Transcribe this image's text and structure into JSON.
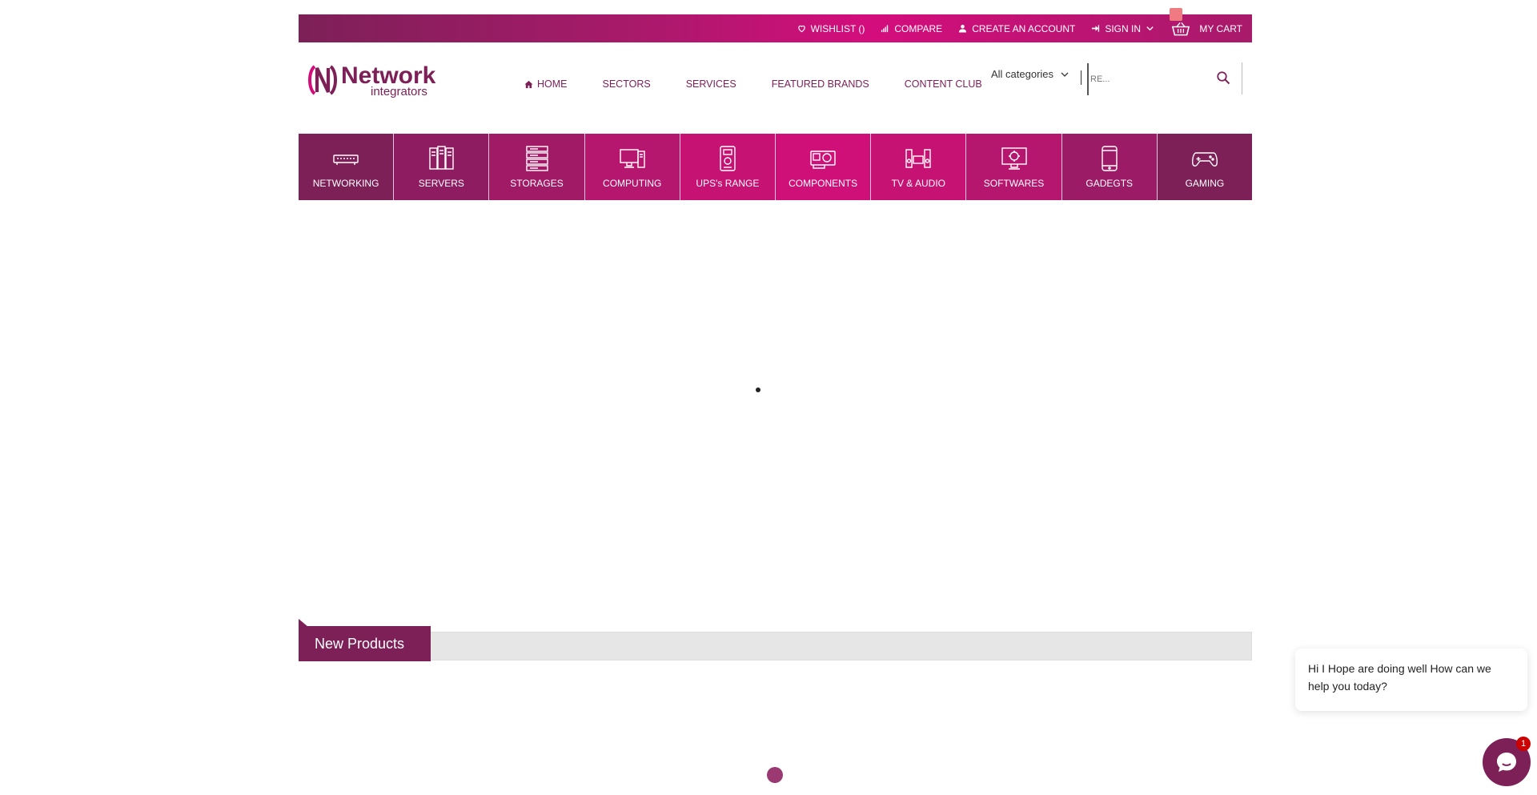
{
  "topbar": {
    "links": [
      {
        "label": "WISHLIST ()",
        "icon": "heart-icon"
      },
      {
        "label": "COMPARE",
        "icon": "bar-chart-icon"
      },
      {
        "label": "CREATE AN ACCOUNT",
        "icon": "user-icon"
      },
      {
        "label": "SIGN IN",
        "icon": "sign-in-icon"
      }
    ],
    "cart_label": "MY CART"
  },
  "logo": {
    "name": "Network",
    "tagline": "integrators"
  },
  "mainnav": [
    {
      "label": "HOME"
    },
    {
      "label": "SECTORS"
    },
    {
      "label": "SERVICES"
    },
    {
      "label": "FEATURED BRANDS"
    },
    {
      "label": "CONTENT CLUB"
    }
  ],
  "search": {
    "category": "All categories",
    "placeholder": "RE..."
  },
  "categories": [
    {
      "label": "NETWORKING",
      "icon": "router-icon",
      "color": "#7d2058"
    },
    {
      "label": "SERVERS",
      "icon": "server-icon",
      "color": "#8e1c60"
    },
    {
      "label": "STORAGES",
      "icon": "storage-icon",
      "color": "#a01a66"
    },
    {
      "label": "COMPUTING",
      "icon": "computer-icon",
      "color": "#b5166e"
    },
    {
      "label": "UPS's RANGE",
      "icon": "ups-icon",
      "color": "#c51273"
    },
    {
      "label": "COMPONENTS",
      "icon": "gpu-icon",
      "color": "#cf1078"
    },
    {
      "label": "TV & AUDIO",
      "icon": "speakers-icon",
      "color": "#c51273"
    },
    {
      "label": "SOFTWARES",
      "icon": "software-icon",
      "color": "#b5166e"
    },
    {
      "label": "GADEGTS",
      "icon": "phone-icon",
      "color": "#9c1b66"
    },
    {
      "label": "GAMING",
      "icon": "gamepad-icon",
      "color": "#7d2058"
    }
  ],
  "new_products": {
    "title": "New Products"
  },
  "chat": {
    "message": "Hi I Hope are doing well How can we help you today?",
    "badge": "1"
  },
  "colors": {
    "brand": "#7d2058",
    "accent": "#d40d7d"
  }
}
